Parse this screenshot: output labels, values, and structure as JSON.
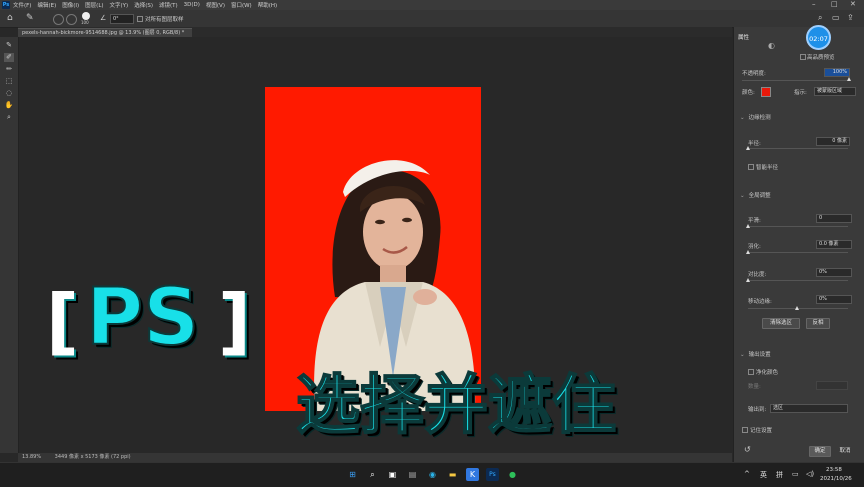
{
  "menu": {
    "items": [
      "文件(F)",
      "编辑(E)",
      "图像(I)",
      "图层(L)",
      "文字(Y)",
      "选择(S)",
      "滤镜(T)",
      "3D(D)",
      "视图(V)",
      "窗口(W)",
      "帮助(H)"
    ],
    "app_logo": "Ps",
    "window_controls": [
      "–",
      "□",
      "✕"
    ]
  },
  "options_bar": {
    "brush_size": "100",
    "angle": "0°",
    "sample_all_layers": "对所有图层取样"
  },
  "document": {
    "tab_title": "pexels-hannah-bickmore-9514688.jpg @ 13.9% (图层 0, RGB/8) *",
    "tab_close": "×",
    "bg_color": "#ff1a00"
  },
  "status": {
    "zoom": "13.89%",
    "size": "3449 像素 x 5173 像素 (72 ppi)"
  },
  "panel": {
    "tab": "属性",
    "high_quality_preview": "高品质预览",
    "opacity_label": "不透明度:",
    "opacity_value": "100%",
    "color_label": "颜色:",
    "color_value": "#e8190a",
    "indicate_label": "指示:",
    "indicate_value": "被蒙版区域",
    "edge_detection": "边缘检测",
    "radius_label": "半径:",
    "radius_value": "0 像素",
    "smart_radius": "智能半径",
    "global_refine": "全局调整",
    "smooth_label": "平滑:",
    "smooth_value": "0",
    "feather_label": "羽化:",
    "feather_value": "0.0 像素",
    "contrast_label": "对比度:",
    "contrast_value": "0%",
    "shift_edge_label": "移动边缘:",
    "shift_edge_value": "0%",
    "clear_selection": "清除选区",
    "invert": "反相",
    "output_settings": "输出设置",
    "decontaminate": "净化颜色",
    "amount_label": "数量:",
    "output_to_label": "输出到:",
    "output_to_value": "选区",
    "remember_settings": "记住设置",
    "ok": "确定",
    "cancel": "取消"
  },
  "timer": "02:07",
  "overlay": {
    "ps_text": "PS",
    "bracket_left": "[",
    "bracket_right": "]",
    "title": "选择并遮住",
    "color": "#18e0e8"
  },
  "taskbar": {
    "tray_caret": "^",
    "lang1": "英",
    "lang2": "拼",
    "time": "23:58",
    "date": "2021/10/26"
  }
}
